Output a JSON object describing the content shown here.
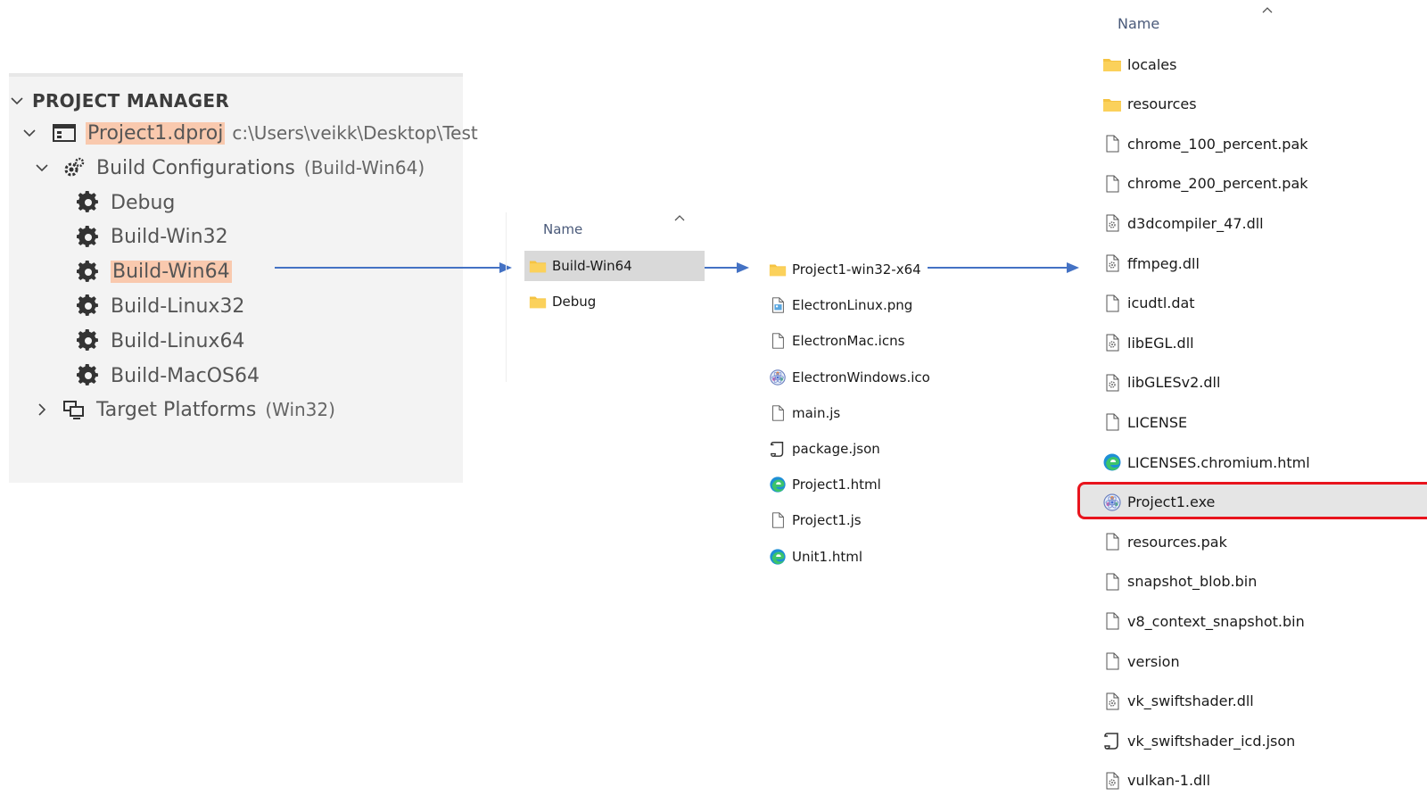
{
  "project_manager": {
    "header": "PROJECT MANAGER",
    "project_name": "Project1.dproj",
    "project_path": "c:\\Users\\veikk\\Desktop\\Test",
    "build_configurations_label": "Build Configurations",
    "build_configurations_active": "(Build-Win64)",
    "configurations": [
      "Debug",
      "Build-Win32",
      "Build-Win64",
      "Build-Linux32",
      "Build-Linux64",
      "Build-MacOS64"
    ],
    "target_platforms_label": "Target Platforms",
    "target_platforms_active": "(Win32)"
  },
  "explorer_1": {
    "column_header": "Name",
    "items": [
      {
        "name": "Build-Win64",
        "icon": "folder-icon",
        "selected": true
      },
      {
        "name": "Debug",
        "icon": "folder-icon",
        "selected": false
      }
    ]
  },
  "explorer_2": {
    "items": [
      {
        "name": "Project1-win32-x64",
        "icon": "folder-icon"
      },
      {
        "name": "ElectronLinux.png",
        "icon": "image-file-icon"
      },
      {
        "name": "ElectronMac.icns",
        "icon": "file-icon"
      },
      {
        "name": "ElectronWindows.ico",
        "icon": "app-icon"
      },
      {
        "name": "main.js",
        "icon": "file-icon"
      },
      {
        "name": "package.json",
        "icon": "script-file-icon"
      },
      {
        "name": "Project1.html",
        "icon": "edge-icon"
      },
      {
        "name": "Project1.js",
        "icon": "file-icon"
      },
      {
        "name": "Unit1.html",
        "icon": "edge-icon"
      }
    ]
  },
  "explorer_3": {
    "column_header": "Name",
    "items": [
      {
        "name": "locales",
        "icon": "folder-icon"
      },
      {
        "name": "resources",
        "icon": "folder-icon"
      },
      {
        "name": "chrome_100_percent.pak",
        "icon": "file-icon"
      },
      {
        "name": "chrome_200_percent.pak",
        "icon": "file-icon"
      },
      {
        "name": "d3dcompiler_47.dll",
        "icon": "dll-file-icon"
      },
      {
        "name": "ffmpeg.dll",
        "icon": "dll-file-icon"
      },
      {
        "name": "icudtl.dat",
        "icon": "file-icon"
      },
      {
        "name": "libEGL.dll",
        "icon": "dll-file-icon"
      },
      {
        "name": "libGLESv2.dll",
        "icon": "dll-file-icon"
      },
      {
        "name": "LICENSE",
        "icon": "file-icon"
      },
      {
        "name": "LICENSES.chromium.html",
        "icon": "edge-icon"
      },
      {
        "name": "Project1.exe",
        "icon": "app-icon",
        "highlighted": true
      },
      {
        "name": "resources.pak",
        "icon": "file-icon"
      },
      {
        "name": "snapshot_blob.bin",
        "icon": "file-icon"
      },
      {
        "name": "v8_context_snapshot.bin",
        "icon": "file-icon"
      },
      {
        "name": "version",
        "icon": "file-icon"
      },
      {
        "name": "vk_swiftshader.dll",
        "icon": "dll-file-icon"
      },
      {
        "name": "vk_swiftshader_icd.json",
        "icon": "script-file-icon"
      },
      {
        "name": "vulkan-1.dll",
        "icon": "dll-file-icon"
      }
    ]
  },
  "colors": {
    "highlight_orange": "#f9c9ae",
    "arrow_blue": "#4472c4",
    "red_box": "#e8141d",
    "selection_gray": "#d9d9d9"
  }
}
